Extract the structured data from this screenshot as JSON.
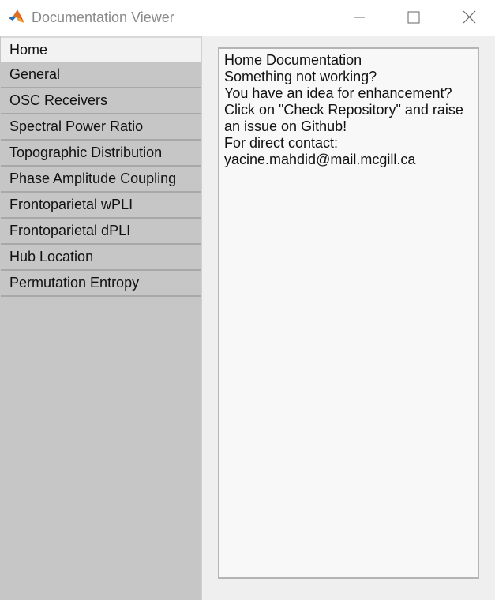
{
  "window": {
    "title": "Documentation Viewer",
    "app_icon": "matlab-logo-icon"
  },
  "tabs": [
    {
      "label": "Home",
      "selected": true
    },
    {
      "label": "General",
      "selected": false
    },
    {
      "label": "OSC Receivers",
      "selected": false
    },
    {
      "label": "Spectral Power Ratio",
      "selected": false
    },
    {
      "label": "Topographic Distribution",
      "selected": false
    },
    {
      "label": "Phase Amplitude Coupling",
      "selected": false
    },
    {
      "label": "Frontoparietal wPLI",
      "selected": false
    },
    {
      "label": "Frontoparietal dPLI",
      "selected": false
    },
    {
      "label": "Hub Location",
      "selected": false
    },
    {
      "label": "Permutation Entropy",
      "selected": false
    }
  ],
  "content": {
    "lines": [
      "Home Documentation",
      "Something not working?",
      "You have an idea for enhancement?",
      "Click on \"Check Repository\" and raise",
      "an issue on Github!",
      "For direct contact:",
      "yacine.mahdid@mail.mcgill.ca"
    ]
  }
}
